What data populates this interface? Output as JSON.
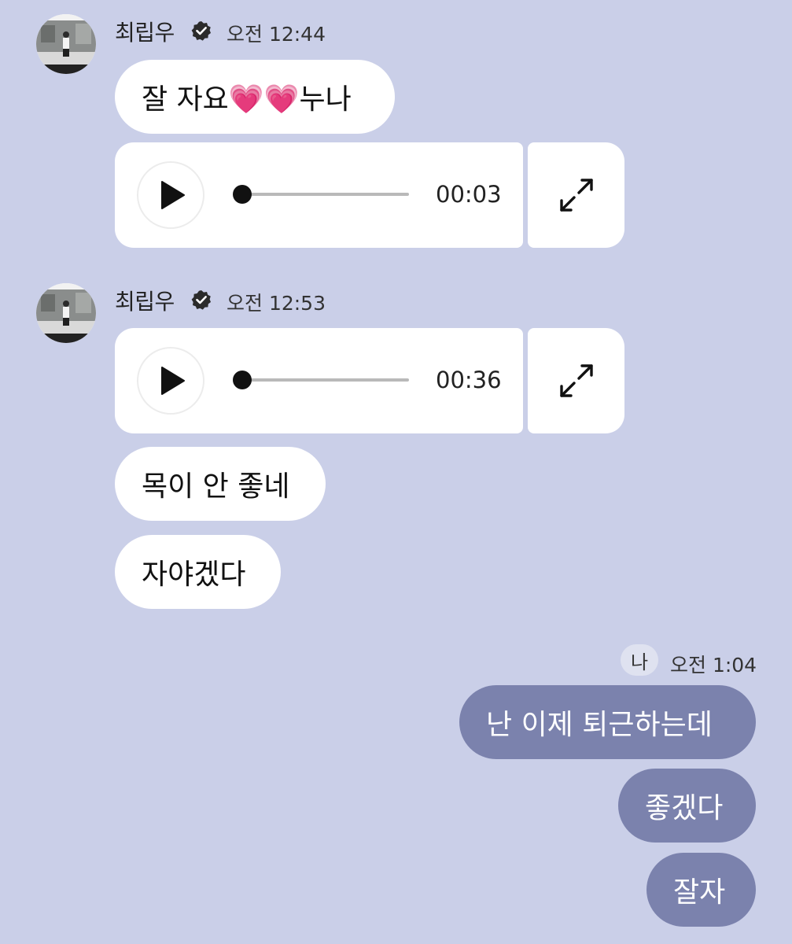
{
  "groups": [
    {
      "sender": "최립우",
      "time": "오전 12:44",
      "messages": [
        {
          "type": "text",
          "text": "잘 자요💗💗누나"
        },
        {
          "type": "voice",
          "duration": "00:03",
          "progress": 0.0
        }
      ]
    },
    {
      "sender": "최립우",
      "time": "오전 12:53",
      "messages": [
        {
          "type": "voice",
          "duration": "00:36",
          "progress": 0.0
        },
        {
          "type": "text",
          "text": "목이 안 좋네"
        },
        {
          "type": "text",
          "text": "자야겠다"
        }
      ]
    }
  ],
  "outgoing": {
    "sender_label": "나",
    "time": "오전 1:04",
    "messages": [
      "난 이제 퇴근하는데",
      "좋겠다",
      "잘자"
    ]
  },
  "icons": {
    "verified": "verified-badge-icon",
    "play": "play-icon",
    "expand": "expand-icon"
  },
  "colors": {
    "background": "#cacfe8",
    "incoming_bubble": "#ffffff",
    "outgoing_bubble": "#7b82ad"
  }
}
